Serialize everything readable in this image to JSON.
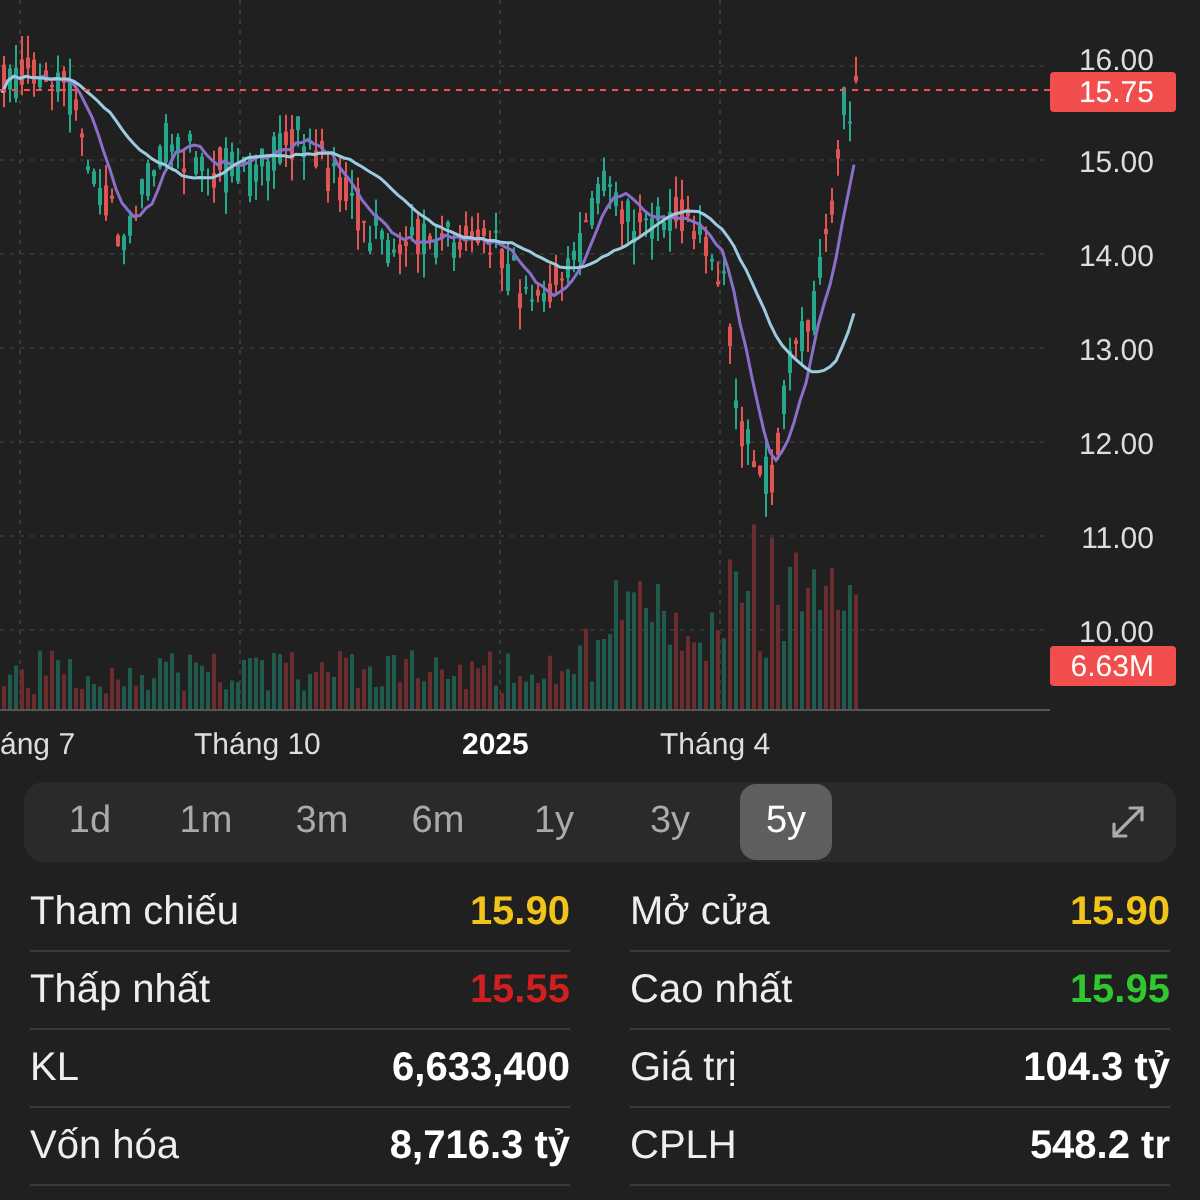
{
  "chart": {
    "y_ticks": [
      "16.00",
      "15.00",
      "14.00",
      "13.00",
      "12.00",
      "11.00",
      "10.00"
    ],
    "price_badge": "15.75",
    "volume_badge": "6.63M",
    "x_labels": [
      {
        "text": "áng 7",
        "emphasis": false
      },
      {
        "text": "Tháng 10",
        "emphasis": false
      },
      {
        "text": "2025",
        "emphasis": true
      },
      {
        "text": "Tháng 4",
        "emphasis": false
      }
    ]
  },
  "ranges": [
    {
      "label": "1d",
      "selected": false
    },
    {
      "label": "1m",
      "selected": false
    },
    {
      "label": "3m",
      "selected": false
    },
    {
      "label": "6m",
      "selected": false
    },
    {
      "label": "1y",
      "selected": false
    },
    {
      "label": "3y",
      "selected": false
    },
    {
      "label": "5y",
      "selected": true
    }
  ],
  "stats": [
    {
      "label": "Tham chiếu",
      "value": "15.90",
      "color": "#f2c318"
    },
    {
      "label": "Mở cửa",
      "value": "15.90",
      "color": "#f2c318"
    },
    {
      "label": "Thấp nhất",
      "value": "15.55",
      "color": "#d01f1f"
    },
    {
      "label": "Cao nhất",
      "value": "15.95",
      "color": "#2fc92f"
    },
    {
      "label": "KL",
      "value": "6,633,400",
      "color": "#ffffff"
    },
    {
      "label": "Giá trị",
      "value": "104.3 tỷ",
      "color": "#ffffff"
    },
    {
      "label": "Vốn hóa",
      "value": "8,716.3 tỷ",
      "color": "#ffffff"
    },
    {
      "label": "CPLH",
      "value": "548.2 tr",
      "color": "#ffffff"
    }
  ]
}
